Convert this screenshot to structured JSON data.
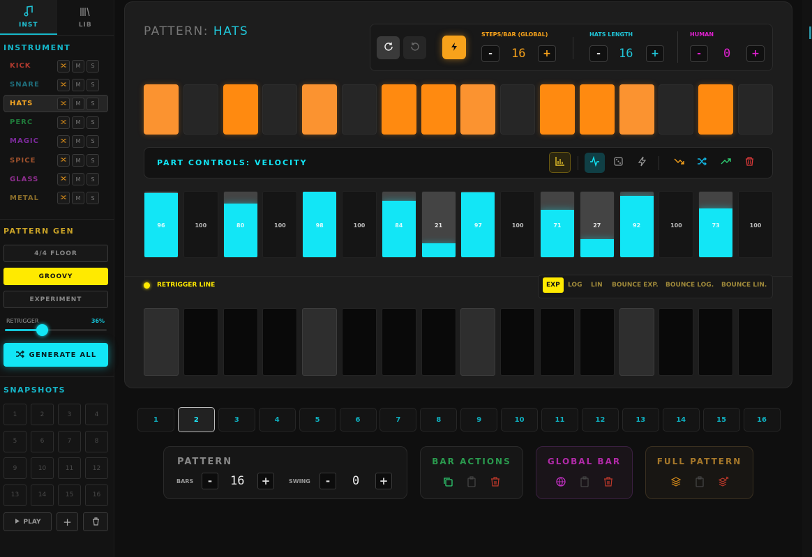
{
  "sidebar": {
    "tabs": [
      {
        "label": "INST",
        "icon": "music-note-icon"
      },
      {
        "label": "LIB",
        "icon": "library-icon"
      }
    ],
    "instrument_heading": "INSTRUMENT",
    "instruments": [
      {
        "name": "KICK",
        "color": "#b03a2e"
      },
      {
        "name": "SNARE",
        "color": "#1f6f7d"
      },
      {
        "name": "HATS",
        "color": "#f5a623"
      },
      {
        "name": "PERC",
        "color": "#1f7a3a"
      },
      {
        "name": "MAGIC",
        "color": "#7b2a9a"
      },
      {
        "name": "SPICE",
        "color": "#a0522d"
      },
      {
        "name": "GLASS",
        "color": "#8e2e8e"
      },
      {
        "name": "METAL",
        "color": "#8a6d2a"
      }
    ],
    "mute_label": "M",
    "solo_label": "S",
    "pattern_gen_heading": "PATTERN GEN",
    "gen_buttons": [
      "4/4 FLOOR",
      "GROOVY",
      "EXPERIMENT"
    ],
    "retrigger_label": "RETRIGGER",
    "retrigger_value": "36%",
    "generate_all_label": "GENERATE ALL",
    "snapshots_heading": "SNAPSHOTS",
    "snapshots": [
      "1",
      "2",
      "3",
      "4",
      "5",
      "6",
      "7",
      "8",
      "9",
      "10",
      "11",
      "12",
      "13",
      "14",
      "15",
      "16"
    ],
    "play_label": "PLAY",
    "add_label": "+"
  },
  "header": {
    "pattern_prefix": "PATTERN:",
    "pattern_name": "HATS",
    "steps_label": "STEPS/BAR (GLOBAL)",
    "steps_value": "16",
    "length_label": "HATS LENGTH",
    "length_value": "16",
    "human_label": "HUMAN",
    "human_value": "0",
    "minus": "-",
    "plus": "+"
  },
  "steps": [
    {
      "active": true,
      "color": "#fb9330"
    },
    {
      "active": false
    },
    {
      "active": true,
      "color": "#ff8a10"
    },
    {
      "active": false
    },
    {
      "active": true,
      "color": "#fb9330"
    },
    {
      "active": false
    },
    {
      "active": true,
      "color": "#ff8a10"
    },
    {
      "active": true,
      "color": "#ff8a10"
    },
    {
      "active": true,
      "color": "#fb9330"
    },
    {
      "active": false
    },
    {
      "active": true,
      "color": "#ff8a10"
    },
    {
      "active": true,
      "color": "#ff8a10"
    },
    {
      "active": true,
      "color": "#fb9330"
    },
    {
      "active": false
    },
    {
      "active": true,
      "color": "#ff8a10"
    },
    {
      "active": false
    }
  ],
  "part_controls": {
    "title": "PART CONTROLS: VELOCITY"
  },
  "velocity": [
    {
      "label": "96",
      "value": 96,
      "active": true
    },
    {
      "label": "100",
      "value": 100,
      "active": false
    },
    {
      "label": "80",
      "value": 80,
      "active": true
    },
    {
      "label": "100",
      "value": 100,
      "active": false
    },
    {
      "label": "98",
      "value": 98,
      "active": true
    },
    {
      "label": "100",
      "value": 100,
      "active": false
    },
    {
      "label": "84",
      "value": 84,
      "active": true
    },
    {
      "label": "21",
      "value": 21,
      "active": true
    },
    {
      "label": "97",
      "value": 97,
      "active": true
    },
    {
      "label": "100",
      "value": 100,
      "active": false
    },
    {
      "label": "71",
      "value": 71,
      "active": true
    },
    {
      "label": "27",
      "value": 27,
      "active": true
    },
    {
      "label": "92",
      "value": 92,
      "active": true
    },
    {
      "label": "100",
      "value": 100,
      "active": false
    },
    {
      "label": "73",
      "value": 73,
      "active": true
    },
    {
      "label": "100",
      "value": 100,
      "active": false
    }
  ],
  "retrigger_line": {
    "label": "RETRIGGER LINE",
    "modes": [
      "EXP",
      "LOG",
      "LIN",
      "BOUNCE EXP.",
      "BOUNCE LOG.",
      "BOUNCE LIN."
    ],
    "active_mode": "EXP",
    "cells": [
      true,
      false,
      false,
      false,
      true,
      false,
      false,
      false,
      true,
      false,
      false,
      false,
      true,
      false,
      false,
      false
    ]
  },
  "bars": [
    "1",
    "2",
    "3",
    "4",
    "5",
    "6",
    "7",
    "8",
    "9",
    "10",
    "11",
    "12",
    "13",
    "14",
    "15",
    "16"
  ],
  "active_bar": "2",
  "pattern_panel": {
    "title": "PATTERN",
    "bars_label": "BARS",
    "bars_value": "16",
    "swing_label": "SWING",
    "swing_value": "0"
  },
  "bar_actions": {
    "title": "BAR ACTIONS"
  },
  "global_bar": {
    "title": "GLOBAL BAR"
  },
  "full_pattern": {
    "title": "FULL PATTERN"
  },
  "colors": {
    "accent_cyan": "#12e6f6",
    "accent_orange": "#ff8a10",
    "accent_yellow": "#ffea00"
  }
}
